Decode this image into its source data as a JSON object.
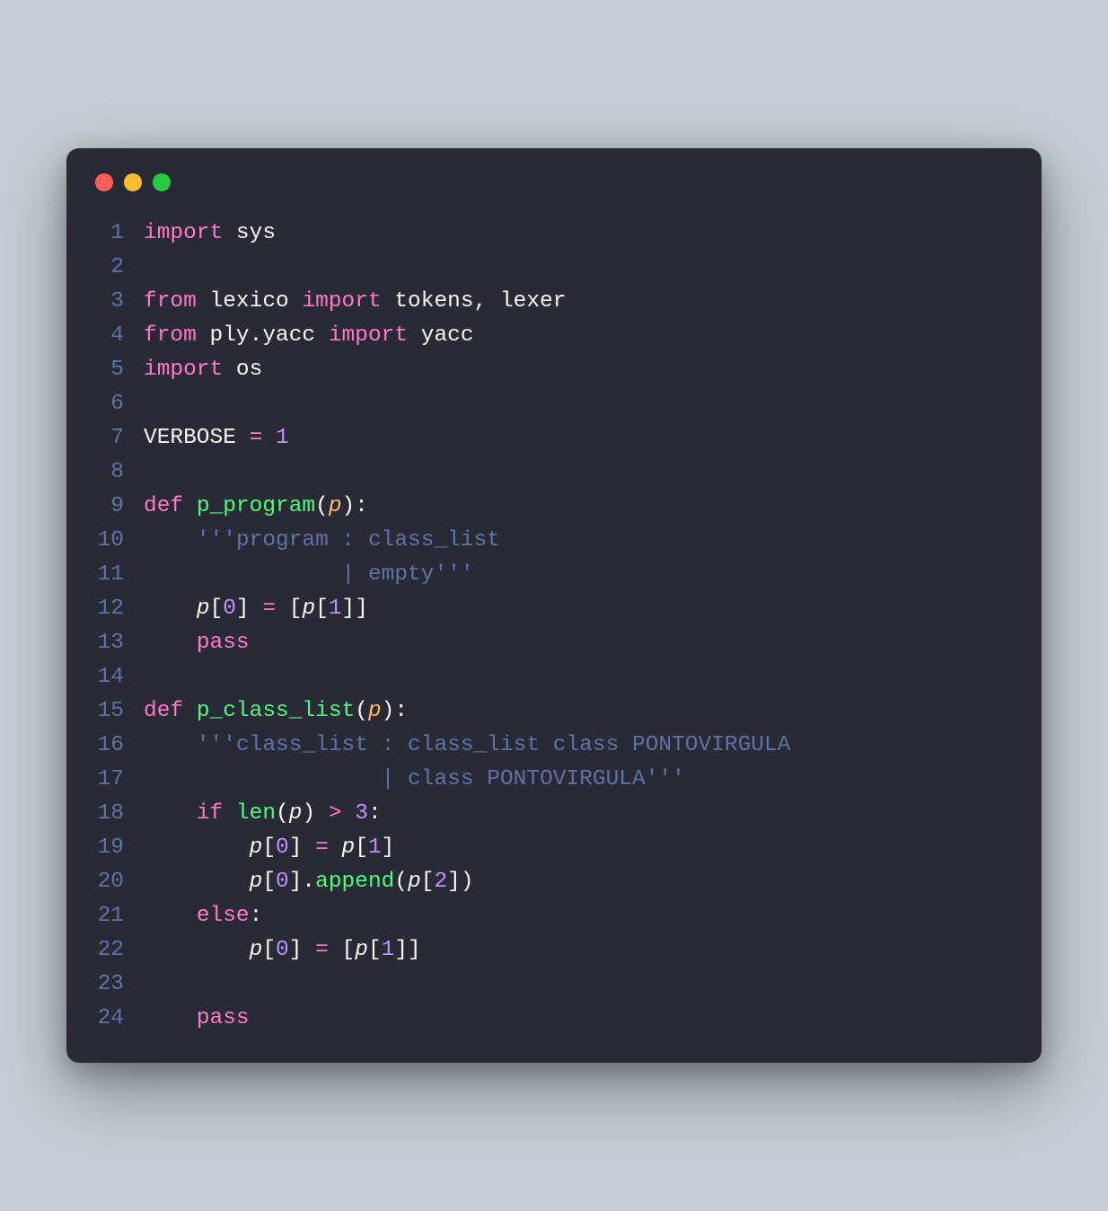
{
  "colors": {
    "bg": "#282a36",
    "body_bg": "#c5ced6",
    "line_number": "#6272a4",
    "keyword": "#ff79c6",
    "function": "#50fa7b",
    "identifier": "#f8f8f2",
    "param": "#ffb86c",
    "number": "#bd93f9",
    "comment": "#6272a4",
    "traffic_red": "#ff5f56",
    "traffic_yellow": "#ffbd2e",
    "traffic_green": "#27c93f"
  },
  "language": "python",
  "lines": [
    {
      "n": "1",
      "tokens": [
        {
          "c": "kw",
          "t": "import"
        },
        {
          "c": "id",
          "t": " sys"
        }
      ]
    },
    {
      "n": "2",
      "tokens": []
    },
    {
      "n": "3",
      "tokens": [
        {
          "c": "kw",
          "t": "from"
        },
        {
          "c": "id",
          "t": " lexico "
        },
        {
          "c": "kw",
          "t": "import"
        },
        {
          "c": "id",
          "t": " tokens, lexer"
        }
      ]
    },
    {
      "n": "4",
      "tokens": [
        {
          "c": "kw",
          "t": "from"
        },
        {
          "c": "id",
          "t": " ply.yacc "
        },
        {
          "c": "kw",
          "t": "import"
        },
        {
          "c": "id",
          "t": " yacc"
        }
      ]
    },
    {
      "n": "5",
      "tokens": [
        {
          "c": "kw",
          "t": "import"
        },
        {
          "c": "id",
          "t": " os"
        }
      ]
    },
    {
      "n": "6",
      "tokens": []
    },
    {
      "n": "7",
      "tokens": [
        {
          "c": "id",
          "t": "VERBOSE "
        },
        {
          "c": "op",
          "t": "="
        },
        {
          "c": "id",
          "t": " "
        },
        {
          "c": "num",
          "t": "1"
        }
      ]
    },
    {
      "n": "8",
      "tokens": []
    },
    {
      "n": "9",
      "tokens": [
        {
          "c": "kw",
          "t": "def"
        },
        {
          "c": "id",
          "t": " "
        },
        {
          "c": "fn",
          "t": "p_program"
        },
        {
          "c": "pn",
          "t": "("
        },
        {
          "c": "param",
          "t": "p"
        },
        {
          "c": "pn",
          "t": "):"
        }
      ]
    },
    {
      "n": "10",
      "tokens": [
        {
          "c": "str",
          "t": "    '''program : class_list"
        }
      ]
    },
    {
      "n": "11",
      "tokens": [
        {
          "c": "str",
          "t": "               | empty'''"
        }
      ]
    },
    {
      "n": "12",
      "tokens": [
        {
          "c": "id",
          "t": "    "
        },
        {
          "c": "pvar",
          "t": "p"
        },
        {
          "c": "pn",
          "t": "["
        },
        {
          "c": "num",
          "t": "0"
        },
        {
          "c": "pn",
          "t": "] "
        },
        {
          "c": "op",
          "t": "="
        },
        {
          "c": "pn",
          "t": " ["
        },
        {
          "c": "pvar",
          "t": "p"
        },
        {
          "c": "pn",
          "t": "["
        },
        {
          "c": "num",
          "t": "1"
        },
        {
          "c": "pn",
          "t": "]]"
        }
      ]
    },
    {
      "n": "13",
      "tokens": [
        {
          "c": "id",
          "t": "    "
        },
        {
          "c": "kw",
          "t": "pass"
        }
      ]
    },
    {
      "n": "14",
      "tokens": []
    },
    {
      "n": "15",
      "tokens": [
        {
          "c": "kw",
          "t": "def"
        },
        {
          "c": "id",
          "t": " "
        },
        {
          "c": "fn",
          "t": "p_class_list"
        },
        {
          "c": "pn",
          "t": "("
        },
        {
          "c": "param",
          "t": "p"
        },
        {
          "c": "pn",
          "t": "):"
        }
      ]
    },
    {
      "n": "16",
      "tokens": [
        {
          "c": "str",
          "t": "    '''class_list : class_list class PONTOVIRGULA"
        }
      ]
    },
    {
      "n": "17",
      "tokens": [
        {
          "c": "str",
          "t": "                  | class PONTOVIRGULA'''"
        }
      ]
    },
    {
      "n": "18",
      "tokens": [
        {
          "c": "id",
          "t": "    "
        },
        {
          "c": "kw",
          "t": "if"
        },
        {
          "c": "id",
          "t": " "
        },
        {
          "c": "fn",
          "t": "len"
        },
        {
          "c": "pn",
          "t": "("
        },
        {
          "c": "pvar",
          "t": "p"
        },
        {
          "c": "pn",
          "t": ") "
        },
        {
          "c": "op",
          "t": ">"
        },
        {
          "c": "id",
          "t": " "
        },
        {
          "c": "num",
          "t": "3"
        },
        {
          "c": "pn",
          "t": ":"
        }
      ]
    },
    {
      "n": "19",
      "tokens": [
        {
          "c": "id",
          "t": "        "
        },
        {
          "c": "pvar",
          "t": "p"
        },
        {
          "c": "pn",
          "t": "["
        },
        {
          "c": "num",
          "t": "0"
        },
        {
          "c": "pn",
          "t": "] "
        },
        {
          "c": "op",
          "t": "="
        },
        {
          "c": "id",
          "t": " "
        },
        {
          "c": "pvar",
          "t": "p"
        },
        {
          "c": "pn",
          "t": "["
        },
        {
          "c": "num",
          "t": "1"
        },
        {
          "c": "pn",
          "t": "]"
        }
      ]
    },
    {
      "n": "20",
      "tokens": [
        {
          "c": "id",
          "t": "        "
        },
        {
          "c": "pvar",
          "t": "p"
        },
        {
          "c": "pn",
          "t": "["
        },
        {
          "c": "num",
          "t": "0"
        },
        {
          "c": "pn",
          "t": "]."
        },
        {
          "c": "fn",
          "t": "append"
        },
        {
          "c": "pn",
          "t": "("
        },
        {
          "c": "pvar",
          "t": "p"
        },
        {
          "c": "pn",
          "t": "["
        },
        {
          "c": "num",
          "t": "2"
        },
        {
          "c": "pn",
          "t": "])"
        }
      ]
    },
    {
      "n": "21",
      "tokens": [
        {
          "c": "id",
          "t": "    "
        },
        {
          "c": "kw",
          "t": "else"
        },
        {
          "c": "pn",
          "t": ":"
        }
      ]
    },
    {
      "n": "22",
      "tokens": [
        {
          "c": "id",
          "t": "        "
        },
        {
          "c": "pvar",
          "t": "p"
        },
        {
          "c": "pn",
          "t": "["
        },
        {
          "c": "num",
          "t": "0"
        },
        {
          "c": "pn",
          "t": "] "
        },
        {
          "c": "op",
          "t": "="
        },
        {
          "c": "pn",
          "t": " ["
        },
        {
          "c": "pvar",
          "t": "p"
        },
        {
          "c": "pn",
          "t": "["
        },
        {
          "c": "num",
          "t": "1"
        },
        {
          "c": "pn",
          "t": "]]"
        }
      ]
    },
    {
      "n": "23",
      "tokens": []
    },
    {
      "n": "24",
      "tokens": [
        {
          "c": "id",
          "t": "    "
        },
        {
          "c": "kw",
          "t": "pass"
        }
      ]
    }
  ]
}
